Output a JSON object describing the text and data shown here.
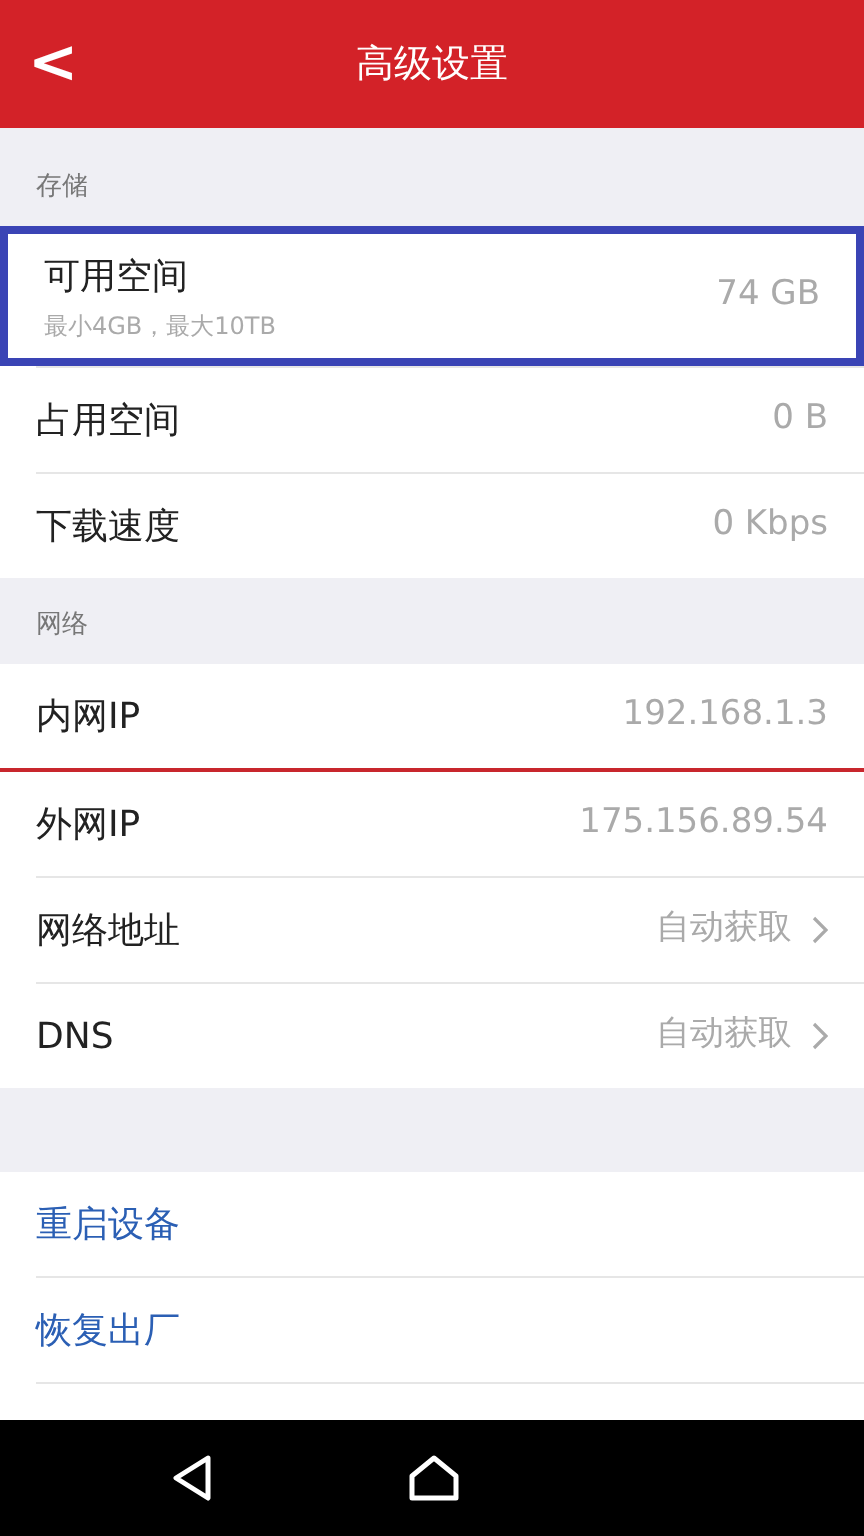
{
  "header": {
    "back": "<",
    "title": "高级设置"
  },
  "sections": [
    {
      "label": "存储",
      "rows": [
        {
          "kind": "detail",
          "label": "可用空间",
          "sublabel": "最小4GB，最大10TB",
          "value": "74 GB",
          "highlighted": true,
          "chevron": false,
          "red_rule": false
        },
        {
          "kind": "value",
          "label": "占用空间",
          "value": "0 B",
          "highlighted": false,
          "chevron": false,
          "red_rule": false
        },
        {
          "kind": "value",
          "label": "下载速度",
          "value": "0 Kbps",
          "highlighted": false,
          "chevron": false,
          "red_rule": false
        }
      ]
    },
    {
      "label": "网络",
      "rows": [
        {
          "kind": "value",
          "label": "内网IP",
          "value": "192.168.1.3",
          "highlighted": false,
          "chevron": false,
          "red_rule": true
        },
        {
          "kind": "value",
          "label": "外网IP",
          "value": "175.156.89.54",
          "highlighted": false,
          "chevron": false,
          "red_rule": false
        },
        {
          "kind": "value",
          "label": "网络地址",
          "value": "自动获取",
          "highlighted": false,
          "chevron": true,
          "red_rule": false
        },
        {
          "kind": "value",
          "label": "DNS",
          "value": "自动获取",
          "highlighted": false,
          "chevron": true,
          "red_rule": false
        }
      ]
    }
  ],
  "actions": [
    {
      "label": "重启设备"
    },
    {
      "label": "恢复出厂"
    }
  ]
}
